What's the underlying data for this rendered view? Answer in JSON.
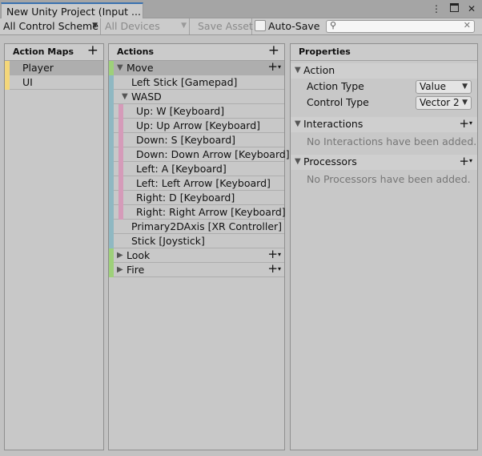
{
  "window": {
    "tab_title": "New Unity Project (Input ...",
    "menu_icon": "kebab-menu-icon",
    "maximize_icon": "maximize-icon",
    "close_icon": "close-icon"
  },
  "toolbar": {
    "control_scheme": "All Control Scheme",
    "devices": "All Devices",
    "save_asset": "Save Asset",
    "auto_save_label": "Auto-Save",
    "auto_save_checked": false,
    "search_value": "",
    "search_placeholder": ""
  },
  "action_maps": {
    "header": "Action Maps",
    "items": [
      {
        "label": "Player",
        "color": "#f4d77a",
        "selected": true
      },
      {
        "label": "UI",
        "color": "#f4d77a",
        "selected": false
      }
    ]
  },
  "actions": {
    "header": "Actions",
    "rows": [
      {
        "label": "Move",
        "kind": "action",
        "expanded": true
      },
      {
        "label": "Left Stick [Gamepad]",
        "kind": "binding"
      },
      {
        "label": "WASD",
        "kind": "composite",
        "expanded": true
      },
      {
        "label": "Up: W [Keyboard]",
        "kind": "part"
      },
      {
        "label": "Up: Up Arrow [Keyboard]",
        "kind": "part"
      },
      {
        "label": "Down: S [Keyboard]",
        "kind": "part"
      },
      {
        "label": "Down: Down Arrow [Keyboard]",
        "kind": "part"
      },
      {
        "label": "Left: A [Keyboard]",
        "kind": "part"
      },
      {
        "label": "Left: Left Arrow [Keyboard]",
        "kind": "part"
      },
      {
        "label": "Right: D [Keyboard]",
        "kind": "part"
      },
      {
        "label": "Right: Right Arrow [Keyboard]",
        "kind": "part"
      },
      {
        "label": "Primary2DAxis [XR Controller]",
        "kind": "binding"
      },
      {
        "label": "Stick [Joystick]",
        "kind": "binding"
      },
      {
        "label": "Look",
        "kind": "action",
        "expanded": false
      },
      {
        "label": "Fire",
        "kind": "action",
        "expanded": false
      }
    ],
    "colors": {
      "action": "#9ed07a",
      "binding": "#8fb8c2",
      "part": "#d59bb9"
    }
  },
  "properties": {
    "header": "Properties",
    "action_section": "Action",
    "action_type_label": "Action Type",
    "action_type_value": "Value",
    "control_type_label": "Control Type",
    "control_type_value": "Vector 2",
    "interactions_section": "Interactions",
    "interactions_empty": "No Interactions have been added.",
    "processors_section": "Processors",
    "processors_empty": "No Processors have been added."
  }
}
